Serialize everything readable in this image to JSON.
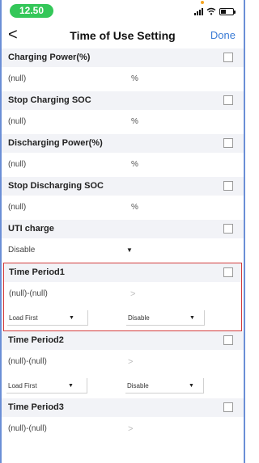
{
  "status": {
    "time": "12.50"
  },
  "nav": {
    "back": "<",
    "title": "Time of Use Setting",
    "done": "Done"
  },
  "sections": {
    "charging_power": {
      "label": "Charging Power(%)",
      "value": "(null)",
      "unit": "%"
    },
    "stop_charging": {
      "label": "Stop Charging SOC",
      "value": "(null)",
      "unit": "%"
    },
    "discharging_power": {
      "label": "Discharging Power(%)",
      "value": "(null)",
      "unit": "%"
    },
    "stop_discharging": {
      "label": "Stop Discharging SOC",
      "value": "(null)",
      "unit": "%"
    },
    "uti_charge": {
      "label": "UTI charge",
      "value": "Disable",
      "caret": "▼"
    }
  },
  "periods": [
    {
      "label": "Time Period1",
      "range": "(null)-(null)",
      "arrow": ">",
      "mode": "Load First",
      "state": "Disable",
      "caret": "▼"
    },
    {
      "label": "Time Period2",
      "range": "(null)-(null)",
      "arrow": ">",
      "mode": "Load First",
      "state": "Disable",
      "caret": "▼"
    },
    {
      "label": "Time Period3",
      "range": "(null)-(null)",
      "arrow": ">"
    }
  ],
  "colors": {
    "accent": "#3a7bd5",
    "time_pill": "#34c759",
    "highlight": "#d33b3b",
    "header_bg": "#f2f3f7"
  }
}
